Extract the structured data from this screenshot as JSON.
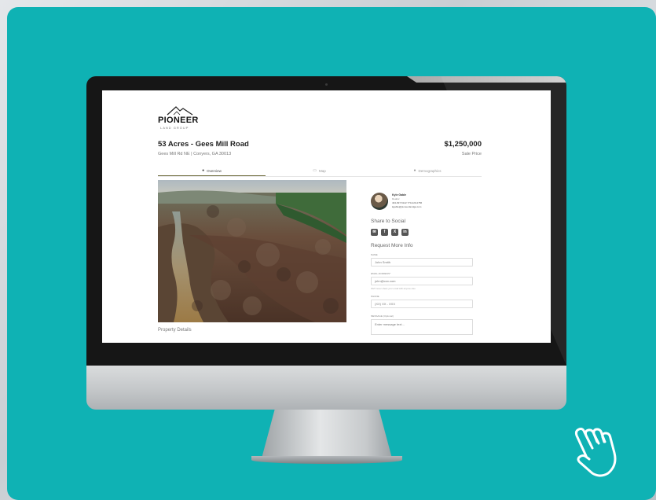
{
  "logo": {
    "name": "PIONEER",
    "subtitle": "LAND GROUP"
  },
  "property": {
    "title": "53 Acres - Gees Mill Road",
    "address": "Gees Mill Rd NE | Conyers, GA 30013",
    "price": "$1,250,000",
    "price_label": "Sale Price"
  },
  "tabs": [
    {
      "label": "Overview",
      "icon": "camera-icon",
      "active": true
    },
    {
      "label": "Map",
      "icon": "map-icon",
      "active": false
    },
    {
      "label": "Demographics",
      "icon": "people-icon",
      "active": false
    }
  ],
  "property_details_label": "Property Details",
  "agent": {
    "name": "Kyle Gable",
    "role": "Realtor",
    "phone": "404-997-5122  770-220-2756",
    "email": "kgable@pioneerlandga.com"
  },
  "share": {
    "title": "Share to Social",
    "icons": [
      "email-icon",
      "facebook-icon",
      "x-icon",
      "linkedin-icon"
    ]
  },
  "request_form": {
    "title": "Request More Info",
    "name_label": "NAME",
    "name_placeholder": "John Smith",
    "email_label": "EMAIL ADDRESS*",
    "email_placeholder": "john@cox.com",
    "email_hint": "We'll never share your email with anyone else",
    "phone_label": "PHONE",
    "phone_placeholder": "(XX) XX - XXX",
    "message_label": "MESSAGE (Optional)",
    "message_placeholder": "Enter message text..."
  },
  "colors": {
    "background": "#0fb2b4",
    "tab_underline": "#6e6b3c"
  }
}
